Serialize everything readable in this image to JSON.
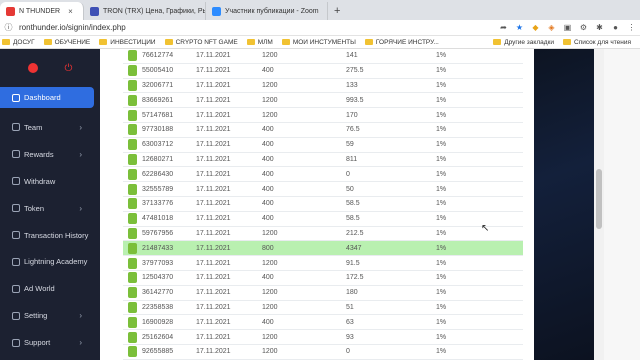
{
  "browser": {
    "tabs": [
      {
        "label": "N THUNDER",
        "favicon_color": "#e53935",
        "active": true
      },
      {
        "label": "TRON (TRX) Цена, Графики, Ры...",
        "favicon_color": "#3f51b5",
        "active": false
      },
      {
        "label": "Участник публикации - Zoom",
        "favicon_color": "#2d8cff",
        "active": false
      }
    ],
    "url": "ronthunder.io/signin/index.php",
    "bookmarks": [
      "ДОСУГ",
      "ОБУЧЕНИЕ",
      "ИНВЕСТИЦИИ",
      "CRYPTO NFT GAME",
      "МЛМ",
      "МОИ ИНСТУМЕНТЫ",
      "ГОРЯЧИЕ ИНСТРУ..."
    ],
    "bookmarks_right": [
      "Другие закладки",
      "Список для чтения"
    ]
  },
  "sidebar": {
    "items": [
      {
        "label": "Dashboard",
        "icon": "dashboard-icon",
        "active": true,
        "chevron": false
      },
      {
        "label": "Team",
        "icon": "team-icon",
        "active": false,
        "chevron": true
      },
      {
        "label": "Rewards",
        "icon": "rewards-icon",
        "active": false,
        "chevron": true
      },
      {
        "label": "Withdraw",
        "icon": "withdraw-icon",
        "active": false,
        "chevron": false
      },
      {
        "label": "Token",
        "icon": "token-icon",
        "active": false,
        "chevron": true
      },
      {
        "label": "Transaction History",
        "icon": "history-icon",
        "active": false,
        "chevron": true
      },
      {
        "label": "Lightning Academy",
        "icon": "academy-icon",
        "active": false,
        "chevron": false
      },
      {
        "label": "Ad World",
        "icon": "ad-icon",
        "active": false,
        "chevron": false
      },
      {
        "label": "Setting",
        "icon": "gear-icon",
        "active": false,
        "chevron": true
      },
      {
        "label": "Support",
        "icon": "support-icon",
        "active": false,
        "chevron": true
      }
    ]
  },
  "table": {
    "rows": [
      {
        "id": "76612774",
        "date": "17.11.2021",
        "amount": "1200",
        "reward": "141",
        "percent": "1%",
        "highlight": false
      },
      {
        "id": "55005410",
        "date": "17.11.2021",
        "amount": "400",
        "reward": "275.5",
        "percent": "1%",
        "highlight": false
      },
      {
        "id": "32006771",
        "date": "17.11.2021",
        "amount": "1200",
        "reward": "133",
        "percent": "1%",
        "highlight": false
      },
      {
        "id": "83669261",
        "date": "17.11.2021",
        "amount": "1200",
        "reward": "993.5",
        "percent": "1%",
        "highlight": false
      },
      {
        "id": "57147681",
        "date": "17.11.2021",
        "amount": "1200",
        "reward": "170",
        "percent": "1%",
        "highlight": false
      },
      {
        "id": "97730188",
        "date": "17.11.2021",
        "amount": "400",
        "reward": "76.5",
        "percent": "1%",
        "highlight": false
      },
      {
        "id": "63003712",
        "date": "17.11.2021",
        "amount": "400",
        "reward": "59",
        "percent": "1%",
        "highlight": false
      },
      {
        "id": "12680271",
        "date": "17.11.2021",
        "amount": "400",
        "reward": "811",
        "percent": "1%",
        "highlight": false
      },
      {
        "id": "62286430",
        "date": "17.11.2021",
        "amount": "400",
        "reward": "0",
        "percent": "1%",
        "highlight": false
      },
      {
        "id": "32555789",
        "date": "17.11.2021",
        "amount": "400",
        "reward": "50",
        "percent": "1%",
        "highlight": false
      },
      {
        "id": "37133776",
        "date": "17.11.2021",
        "amount": "400",
        "reward": "58.5",
        "percent": "1%",
        "highlight": false
      },
      {
        "id": "47481018",
        "date": "17.11.2021",
        "amount": "400",
        "reward": "58.5",
        "percent": "1%",
        "highlight": false
      },
      {
        "id": "59767956",
        "date": "17.11.2021",
        "amount": "1200",
        "reward": "212.5",
        "percent": "1%",
        "highlight": false
      },
      {
        "id": "21487433",
        "date": "17.11.2021",
        "amount": "800",
        "reward": "4347",
        "percent": "1%",
        "highlight": true
      },
      {
        "id": "37977093",
        "date": "17.11.2021",
        "amount": "1200",
        "reward": "91.5",
        "percent": "1%",
        "highlight": false
      },
      {
        "id": "12504370",
        "date": "17.11.2021",
        "amount": "400",
        "reward": "172.5",
        "percent": "1%",
        "highlight": false
      },
      {
        "id": "36142770",
        "date": "17.11.2021",
        "amount": "1200",
        "reward": "180",
        "percent": "1%",
        "highlight": false
      },
      {
        "id": "22358538",
        "date": "17.11.2021",
        "amount": "1200",
        "reward": "51",
        "percent": "1%",
        "highlight": false
      },
      {
        "id": "16900928",
        "date": "17.11.2021",
        "amount": "400",
        "reward": "63",
        "percent": "1%",
        "highlight": false
      },
      {
        "id": "25162604",
        "date": "17.11.2021",
        "amount": "1200",
        "reward": "93",
        "percent": "1%",
        "highlight": false
      },
      {
        "id": "92655885",
        "date": "17.11.2021",
        "amount": "1200",
        "reward": "0",
        "percent": "1%",
        "highlight": false
      }
    ]
  }
}
